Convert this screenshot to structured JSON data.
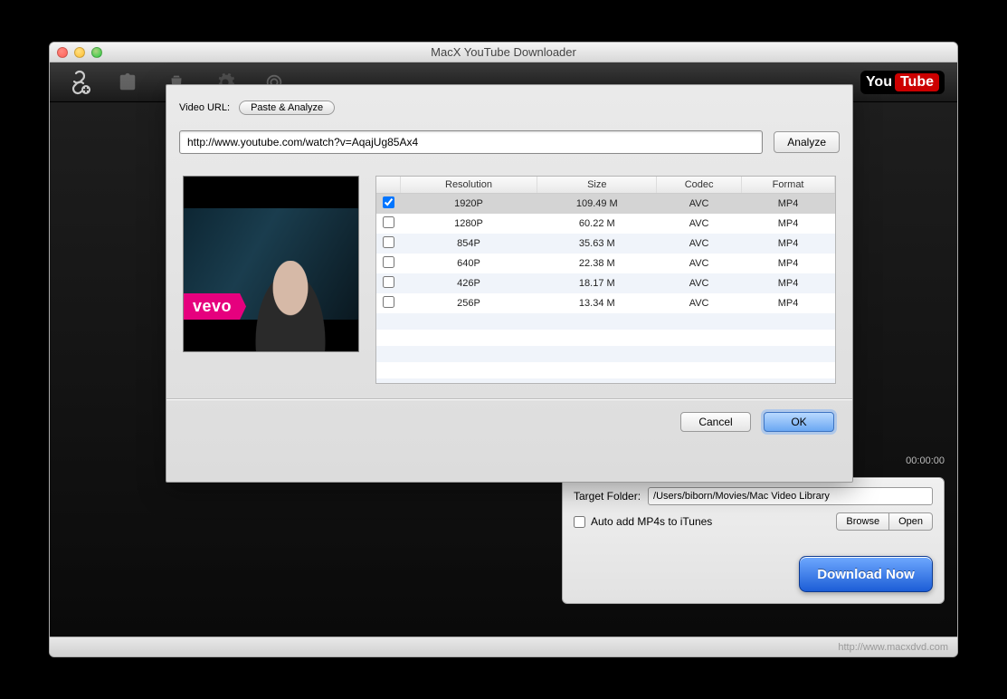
{
  "window": {
    "title": "MacX YouTube Downloader"
  },
  "toolbar": {
    "youtube_brand_prefix": "You",
    "youtube_brand_suffix": "Tube"
  },
  "dialog": {
    "url_label": "Video URL:",
    "paste_analyze_label": "Paste & Analyze",
    "url_value": "http://www.youtube.com/watch?v=AqajUg85Ax4",
    "analyze_label": "Analyze",
    "thumb_brand": "vevo",
    "columns": [
      "Resolution",
      "Size",
      "Codec",
      "Format"
    ],
    "rows": [
      {
        "checked": true,
        "resolution": "1920P",
        "size": "109.49 M",
        "codec": "AVC",
        "format": "MP4"
      },
      {
        "checked": false,
        "resolution": "1280P",
        "size": "60.22 M",
        "codec": "AVC",
        "format": "MP4"
      },
      {
        "checked": false,
        "resolution": "854P",
        "size": "35.63 M",
        "codec": "AVC",
        "format": "MP4"
      },
      {
        "checked": false,
        "resolution": "640P",
        "size": "22.38 M",
        "codec": "AVC",
        "format": "MP4"
      },
      {
        "checked": false,
        "resolution": "426P",
        "size": "18.17 M",
        "codec": "AVC",
        "format": "MP4"
      },
      {
        "checked": false,
        "resolution": "256P",
        "size": "13.34 M",
        "codec": "AVC",
        "format": "MP4"
      }
    ],
    "cancel_label": "Cancel",
    "ok_label": "OK"
  },
  "player": {
    "timecode": "00:00:00"
  },
  "side": {
    "target_folder_label": "Target Folder:",
    "target_folder_value": "/Users/biborn/Movies/Mac Video Library",
    "auto_itunes_label": "Auto add MP4s to iTunes",
    "browse_label": "Browse",
    "open_label": "Open",
    "download_label": "Download Now"
  },
  "footer": {
    "url": "http://www.macxdvd.com"
  }
}
